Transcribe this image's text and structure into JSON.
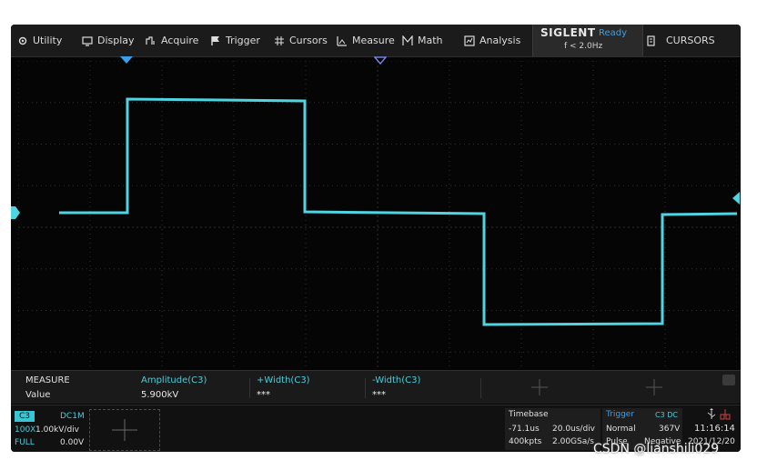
{
  "menu": {
    "utility": "Utility",
    "display": "Display",
    "acquire": "Acquire",
    "trigger": "Trigger",
    "cursors": "Cursors",
    "measure": "Measure",
    "math": "Math",
    "analysis": "Analysis",
    "cursors_panel": "CURSORS"
  },
  "brand": {
    "name": "SIGLENT",
    "status": "Ready",
    "frequency": "f < 2.0Hz"
  },
  "measure": {
    "title": "MEASURE",
    "value_label": "Value",
    "slots": [
      {
        "param": "Amplitude(C3)",
        "value": "5.900kV"
      },
      {
        "param": "+Width(C3)",
        "value": "***"
      },
      {
        "param": "-Width(C3)",
        "value": "***"
      }
    ]
  },
  "channel": {
    "name": "C3",
    "coupling": "DC1M",
    "probe": "100X",
    "scale": "1.00kV/div",
    "bandwidth": "FULL",
    "offset": "0.00V"
  },
  "timebase": {
    "title": "Timebase",
    "delay": "-71.1us",
    "scale": "20.0us/div",
    "memory": "400kpts",
    "sample_rate": "2.00GSa/s"
  },
  "trigger": {
    "title": "Trigger",
    "source": "C3 DC",
    "mode": "Normal",
    "level": "367V",
    "type": "Pulse",
    "slope": "Negative"
  },
  "clock": {
    "time": "11:16:14",
    "date": "2021/12/20"
  },
  "watermark": "CSDN @lianshili029",
  "colors": {
    "trace": "#4fd4e2",
    "grid": "#2e2e2e",
    "accent": "#3c9ee8"
  }
}
